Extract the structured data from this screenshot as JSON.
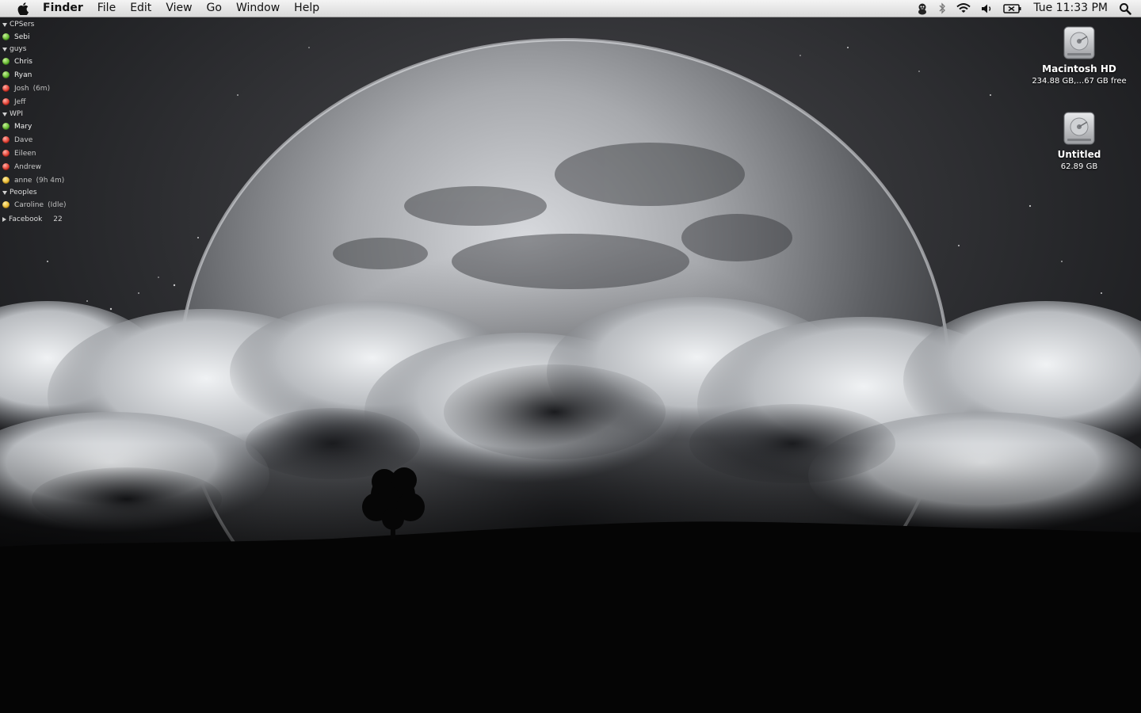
{
  "menubar": {
    "app_name": "Finder",
    "menus": [
      "File",
      "Edit",
      "View",
      "Go",
      "Window",
      "Help"
    ],
    "clock": "Tue 11:33 PM",
    "status_icons": [
      "adium-duck-icon",
      "bluetooth-icon",
      "wifi-icon",
      "volume-icon",
      "battery-icon",
      "spotlight-icon"
    ]
  },
  "buddy_list": {
    "groups": [
      {
        "name": "CPSers",
        "expanded": true,
        "buddies": [
          {
            "name": "Sebi",
            "status": "green",
            "extra": ""
          }
        ]
      },
      {
        "name": "guys",
        "expanded": true,
        "buddies": [
          {
            "name": "Chris",
            "status": "green",
            "extra": ""
          },
          {
            "name": "Ryan",
            "status": "green",
            "extra": ""
          },
          {
            "name": "Josh",
            "status": "red",
            "extra": "(6m)"
          },
          {
            "name": "Jeff",
            "status": "red",
            "extra": ""
          }
        ]
      },
      {
        "name": "WPI",
        "expanded": true,
        "buddies": [
          {
            "name": "Mary",
            "status": "green",
            "extra": ""
          },
          {
            "name": "Dave",
            "status": "red",
            "extra": ""
          },
          {
            "name": "Eileen",
            "status": "red",
            "extra": ""
          },
          {
            "name": "Andrew",
            "status": "red",
            "extra": ""
          },
          {
            "name": "anne",
            "status": "yellow",
            "extra": "(9h 4m)"
          }
        ]
      },
      {
        "name": "Peoples",
        "expanded": true,
        "buddies": [
          {
            "name": "Caroline",
            "status": "yellow",
            "extra": "(Idle)"
          }
        ]
      }
    ],
    "facebook": {
      "name": "Facebook",
      "count": "22"
    }
  },
  "desktop_icons": [
    {
      "name": "Macintosh HD",
      "info": "234.88 GB,…67 GB free",
      "icon": "hard-drive-icon"
    },
    {
      "name": "Untitled",
      "info": "62.89 GB",
      "icon": "hard-drive-icon"
    }
  ]
}
